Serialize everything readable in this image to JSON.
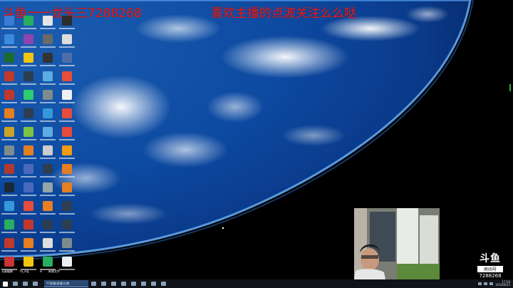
{
  "overlay": {
    "left_text": "斗鱼一一龙头三7288268",
    "right_text": "喜欢主播的点波关注么么哒"
  },
  "desktop": {
    "icon_colors": [
      "#3a7bd5",
      "#27ae60",
      "#e5e5e5",
      "#2d2d2d",
      "#3b8be0",
      "#8e44ad",
      "#6a6a6a",
      "#dcdcdc",
      "#1b6b2e",
      "#f1c40f",
      "#333333",
      "#4f6ea8",
      "#c0392b",
      "#2c3e50",
      "#5dade2",
      "#e74c3c",
      "#c0392b",
      "#2ecc71",
      "#7f8c8d",
      "#f0f0f0",
      "#e67e22",
      "#2c3e50",
      "#3498db",
      "#e74c3c",
      "#c9a227",
      "#7dc242",
      "#5dade2",
      "#e74c3c",
      "#7f8c8d",
      "#e67e22",
      "#cccccc",
      "#f39c12",
      "#b03a2e",
      "#4a69bd",
      "#2c3e50",
      "#e67e22",
      "#1b2838",
      "#4a69bd",
      "#95a5a6",
      "#e67e22",
      "#3498db",
      "#e74c3c",
      "#e67e22",
      "#2c3e50",
      "#27ae60",
      "#c0392b",
      "#2c3e50",
      "#2c3e50",
      "#c0392b",
      "#e67e22",
      "#dddddd",
      "#7f8c8d",
      "#cc3333",
      "#f1c40f",
      "#27ae60",
      "#ecf0f1"
    ],
    "bottom_icon_labels": [
      "无敌破解",
      "tu_stg",
      "iii",
      "新建文件"
    ]
  },
  "watermark": {
    "logo": "斗鱼",
    "room_label": "房间号",
    "room_id": "7288268"
  },
  "taskbar": {
    "active_window_title": "YY直播(直播)主播",
    "clock_time": "17:59",
    "clock_date": "2016/8/23"
  },
  "colors": {
    "overlay_red": "#e81e1e",
    "taskbar_bg": "#101418",
    "accent_green": "#2ea84b"
  }
}
